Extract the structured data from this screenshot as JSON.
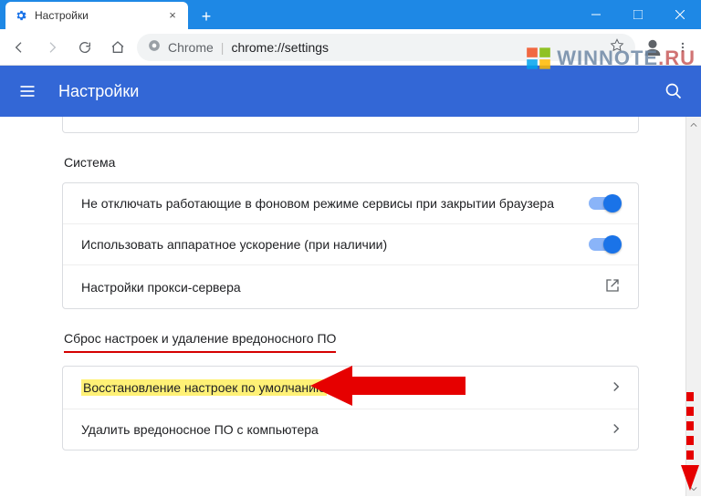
{
  "window": {
    "tab_title": "Настройки",
    "new_tab_tooltip": "+"
  },
  "toolbar": {
    "omnibox_label": "Chrome",
    "omnibox_url": "chrome://settings"
  },
  "app_header": {
    "title": "Настройки"
  },
  "sections": {
    "system": {
      "title": "Система",
      "rows": [
        {
          "label": "Не отключать работающие в фоновом режиме сервисы при закрытии браузера"
        },
        {
          "label": "Использовать аппаратное ускорение (при наличии)"
        },
        {
          "label": "Настройки прокси-сервера"
        }
      ]
    },
    "reset": {
      "title": "Сброс настроек и удаление вредоносного ПО",
      "rows": [
        {
          "label": "Восстановление настроек по умолчанию"
        },
        {
          "label": "Удалить вредоносное ПО с компьютера"
        }
      ]
    }
  },
  "watermark": {
    "text1": "WINNOTE",
    "text2": ".RU"
  }
}
